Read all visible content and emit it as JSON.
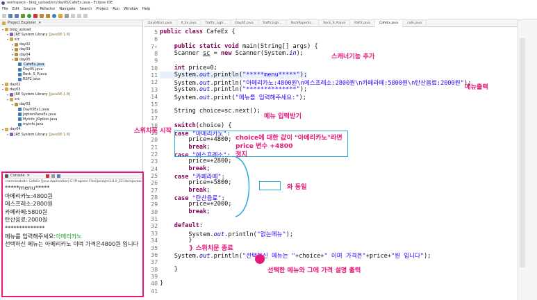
{
  "window": {
    "title": "workspace - blog_upload/src/day05/CafeEx.java - Eclipse IDE"
  },
  "menu": [
    "File",
    "Edit",
    "Source",
    "Refactor",
    "Navigate",
    "Search",
    "Project",
    "Run",
    "Window",
    "Help"
  ],
  "explorer": {
    "title": "Project Explorer",
    "tree": [
      {
        "label": "blog_upload",
        "indent": 0,
        "icon": "project-icon",
        "selected": false
      },
      {
        "label": "JRE System Library",
        "suffix": "[JavaSE-1.8]",
        "indent": 1,
        "icon": "library-icon",
        "selected": false
      },
      {
        "label": "src",
        "indent": 1,
        "icon": "source-folder-icon",
        "selected": false
      },
      {
        "label": "day02",
        "indent": 2,
        "icon": "package-icon",
        "selected": false
      },
      {
        "label": "day03",
        "indent": 2,
        "icon": "package-icon",
        "selected": false
      },
      {
        "label": "day04",
        "indent": 2,
        "icon": "package-icon",
        "selected": false
      },
      {
        "label": "day05",
        "indent": 2,
        "icon": "package-icon",
        "selected": false
      },
      {
        "label": "CafeEx.java",
        "indent": 3,
        "icon": "java-file-icon",
        "selected": true
      },
      {
        "label": "Day05.java",
        "indent": 3,
        "icon": "java-file-icon",
        "selected": false
      },
      {
        "label": "Rock_S_P.java",
        "indent": 3,
        "icon": "java-file-icon",
        "selected": false
      },
      {
        "label": "RSP2.java",
        "indent": 3,
        "icon": "java-file-icon",
        "selected": false
      },
      {
        "label": "day02",
        "indent": 0,
        "icon": "project-icon",
        "selected": false
      },
      {
        "label": "day03",
        "indent": 0,
        "icon": "project-icon",
        "selected": false
      },
      {
        "label": "JRE System Library",
        "suffix": "[JavaSE-1.8]",
        "indent": 1,
        "icon": "library-icon",
        "selected": false
      },
      {
        "label": "src",
        "indent": 1,
        "icon": "source-folder-icon",
        "selected": false
      },
      {
        "label": "day03",
        "indent": 2,
        "icon": "package-icon",
        "selected": false
      },
      {
        "label": "Day03Ex1.java",
        "indent": 3,
        "icon": "java-file-icon",
        "selected": false
      },
      {
        "label": "JoptionPaneEx.java",
        "indent": 3,
        "icon": "java-file-icon",
        "selected": false
      },
      {
        "label": "MyInfo_JOption.java",
        "indent": 3,
        "icon": "java-file-icon",
        "selected": false
      },
      {
        "label": "myinfo.java",
        "indent": 3,
        "icon": "java-file-icon",
        "selected": false
      },
      {
        "label": "day04",
        "indent": 0,
        "icon": "project-icon",
        "selected": false
      },
      {
        "label": "JRE System Library",
        "suffix": "[JavaSE-1.8]",
        "indent": 1,
        "icon": "library-icon",
        "selected": false
      }
    ]
  },
  "console": {
    "title": "Console",
    "terminated": "<terminated> CafeEx [Java Application] C:\\Program Files\\Java\\jre1.8.0_221\\bin\\javaw.exe",
    "lines": [
      {
        "text": "*****menu*****",
        "input": ""
      },
      {
        "text": "아메리카노:4800원",
        "input": ""
      },
      {
        "text": "에스프레소:2800원",
        "input": ""
      },
      {
        "text": "카페라떼:5800원",
        "input": ""
      },
      {
        "text": "탄산음료:2000원",
        "input": ""
      },
      {
        "text": "**************",
        "input": ""
      },
      {
        "text": "메뉴를 입력해주세요:",
        "input": "아메리카노"
      },
      {
        "text": "선택하신 메뉴는 아메리카노 이며 가격은4800원 입니다",
        "input": ""
      }
    ]
  },
  "editor": {
    "tabs": [
      "Day04Ex1.java",
      "If_Ex.java",
      "Traffic_Ligh...",
      "Day05.java",
      "TrafficLigh...",
      "RockPaperSc...",
      "Rock_S_P.java",
      "RSP2.java",
      "CafeEx.java",
      "cafe.java"
    ],
    "active_tab": "CafeEx.java",
    "lines": [
      {
        "n": "5",
        "html": "<span class='kw'>public class</span> CafeEx {"
      },
      {
        "n": "6",
        "html": ""
      },
      {
        "n": "7∘",
        "html": "    <span class='kw'>public static void</span> main(String[] args) {"
      },
      {
        "n": "8",
        "html": "    Scanner <u>sc</u> = <span class='kw'>new</span> Scanner(System.<span class='fld'>in</span>);"
      },
      {
        "n": "9",
        "html": ""
      },
      {
        "n": "10",
        "html": "    <span class='kw'>int</span> price=0;"
      },
      {
        "n": "11",
        "html": "    System.<span class='fld'>out</span>.println(<span class='str'>\"*****menu*****\"</span>);",
        "hl": true
      },
      {
        "n": "12",
        "html": "    System.<span class='fld'>out</span>.println(<span class='str'>\"아메리카노:4800원\\n에스프레소:2800원\\n카페라떼:5800원\\n탄산음료:2000원\"</span>);"
      },
      {
        "n": "13",
        "html": "    System.<span class='fld'>out</span>.println(<span class='str'>\"**************\"</span>);"
      },
      {
        "n": "14",
        "html": "    System.<span class='fld'>out</span>.print(<span class='str'>\"메뉴를 입력해주세요:\"</span>);"
      },
      {
        "n": "15",
        "html": ""
      },
      {
        "n": "16",
        "html": "    String choice=sc.next();"
      },
      {
        "n": "17",
        "html": ""
      },
      {
        "n": "18",
        "html": "    <span class='kw'>switch</span>(choice) {"
      },
      {
        "n": "19",
        "html": "    <span class='kw'>case</span> <span class='str'>\"아메리카노\"</span>:"
      },
      {
        "n": "20",
        "html": "        price=+4800;"
      },
      {
        "n": "21",
        "html": "        <span class='kw'>break</span>;"
      },
      {
        "n": "22",
        "html": "    <span class='kw'>case</span> <span class='str'>\"에스프레소\"</span>:"
      },
      {
        "n": "23",
        "html": "        price=+2800;"
      },
      {
        "n": "24",
        "html": "        <span class='kw'>break</span>;"
      },
      {
        "n": "25",
        "html": "    <span class='kw'>case</span> <span class='str'>\"카페라떼\"</span>:"
      },
      {
        "n": "26",
        "html": "        price=+5800;"
      },
      {
        "n": "27",
        "html": "        <span class='kw'>break</span>;"
      },
      {
        "n": "28",
        "html": "    <span class='kw'>case</span> <span class='str'>\"탄산음료\"</span>:"
      },
      {
        "n": "29",
        "html": "        price=+2000;"
      },
      {
        "n": "30",
        "html": "        <span class='kw'>break</span>;"
      },
      {
        "n": "31",
        "html": ""
      },
      {
        "n": "32",
        "html": "    <span class='kw'>default</span>:"
      },
      {
        "n": "33",
        "html": "        System.<span class='fld'>out</span>.println(<span class='str'>\"없는메뉴\"</span>);"
      },
      {
        "n": "34",
        "html": "        }"
      },
      {
        "n": "35",
        "html": ""
      },
      {
        "n": "36",
        "html": "    System.<span class='fld'>out</span>.println(<span class='str'>\"선택하신 메뉴는 \"</span>+choice+<span class='str'>\" 이며 가격은\"</span>+price+<span class='str'>\"원 입니다\"</span>);"
      },
      {
        "n": "37",
        "html": ""
      },
      {
        "n": "38",
        "html": "    }"
      },
      {
        "n": "39",
        "html": ""
      },
      {
        "n": "40",
        "html": "}"
      },
      {
        "n": "41",
        "html": ""
      }
    ]
  },
  "annotations": {
    "scanner": "스캐너기능 추가",
    "menu_print": "메뉴출력",
    "menu_input": "메뉴 입력받기",
    "switch_start": "스위치문 시작",
    "case_line1": "choice에 대한 값이 \"아메리카노\"라면",
    "case_line2": "price 변수 +4800",
    "case_line3": "정지",
    "same": "와 동일",
    "switch_end": "} 스위치문 종료",
    "result": "선택한 메뉴와 그에 가격 설명 출력"
  },
  "colors": {
    "annotation": "#e6197b",
    "box": "#29a9e0"
  }
}
